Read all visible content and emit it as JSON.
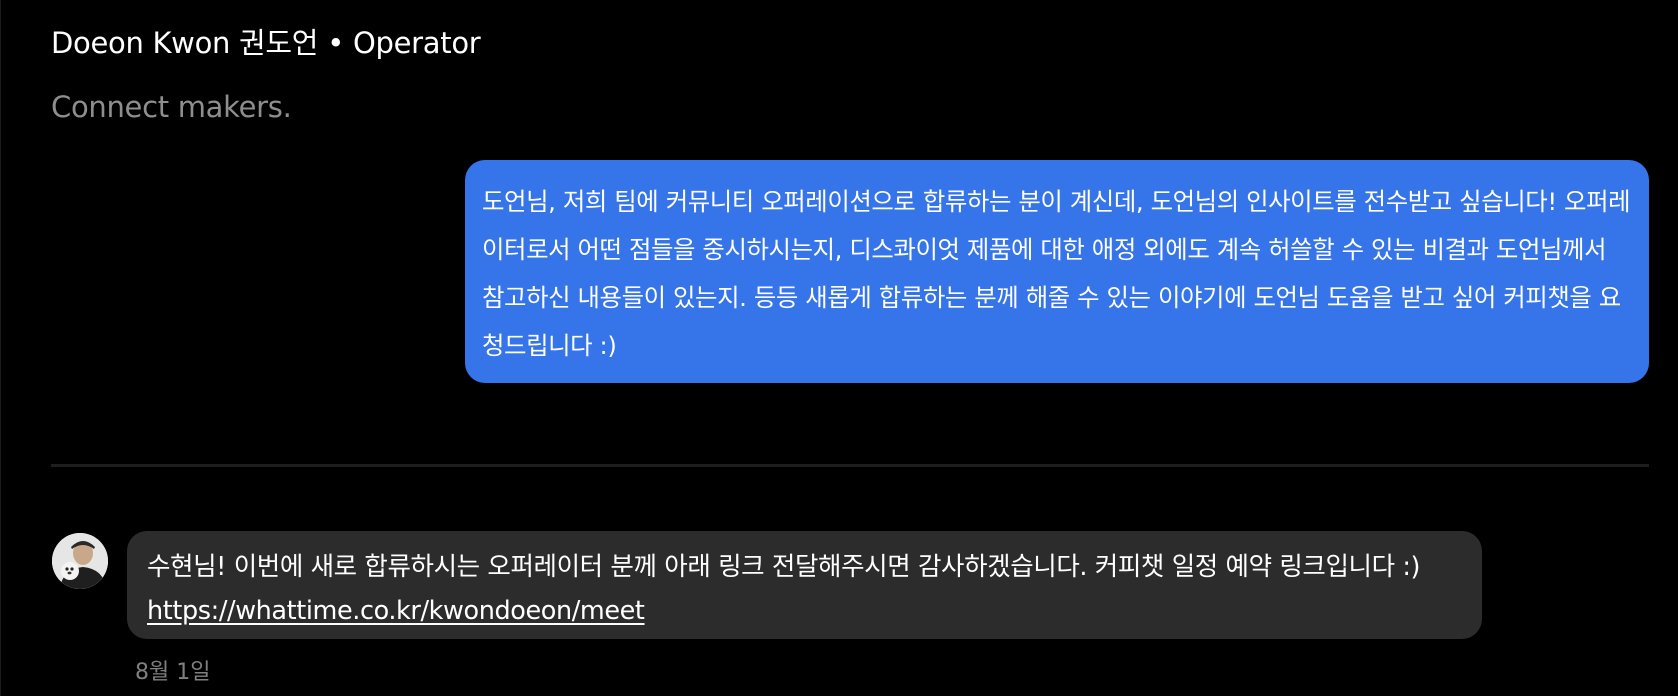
{
  "profile": {
    "name": "Doeon Kwon 권도언",
    "separator": "•",
    "role": "Operator",
    "tagline": "Connect makers."
  },
  "messages": {
    "sent": {
      "text": "도언님, 저희 팀에 커뮤니티 오퍼레이션으로 합류하는 분이 계신데, 도언님의 인사이트를 전수받고 싶습니다! 오퍼레이터로서 어떤 점들을 중시하시는지, 디스콰이엇 제품에 대한 애정 외에도 계속 허쓸할 수 있는 비결과 도언님께서 참고하신 내용들이 있는지. 등등 새롭게 합류하는 분께 해줄 수 있는 이야기에 도언님 도움을 받고 싶어 커피챗을 요청드립니다 :)"
    },
    "received": {
      "text": "수현님! 이번에 새로 합류하시는 오퍼레이터 분께 아래 링크 전달해주시면 감사하겠습니다. 커피챗 일정 예약 링크입니다 :)",
      "link": "https://whattime.co.kr/kwondoeon/meet",
      "timestamp": "8월 1일"
    }
  },
  "colors": {
    "background": "#000000",
    "sent_bubble": "#3674ea",
    "received_bubble": "#2c2c2c",
    "muted_text": "#8e8e8e"
  }
}
